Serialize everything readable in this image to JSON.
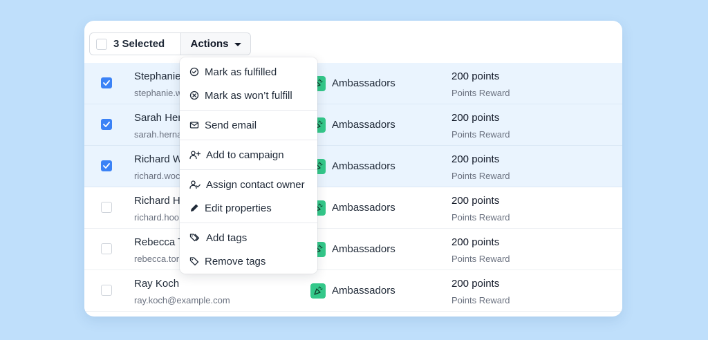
{
  "toolbar": {
    "selected_label": "3 Selected",
    "actions_label": "Actions"
  },
  "menu": {
    "mark_fulfilled": "Mark as fulfilled",
    "mark_wont_fulfill": "Mark as won’t fulfill",
    "send_email": "Send email",
    "add_to_campaign": "Add to campaign",
    "assign_owner": "Assign contact owner",
    "edit_properties": "Edit properties",
    "add_tags": "Add tags",
    "remove_tags": "Remove tags"
  },
  "rows": [
    {
      "name": "Stephanie",
      "email": "stephanie.w",
      "tier": "Ambassadors",
      "points": "200 points",
      "reward": "Points Reward",
      "checked": true
    },
    {
      "name": "Sarah Her",
      "email": "sarah.herna",
      "tier": "Ambassadors",
      "points": "200 points",
      "reward": "Points Reward",
      "checked": true
    },
    {
      "name": "Richard W",
      "email": "richard.woc",
      "tier": "Ambassadors",
      "points": "200 points",
      "reward": "Points Reward",
      "checked": true
    },
    {
      "name": "Richard H",
      "email": "richard.hoo",
      "tier": "Ambassadors",
      "points": "200 points",
      "reward": "Points Reward",
      "checked": false
    },
    {
      "name": "Rebecca T",
      "email": "rebecca.tor",
      "tier": "Ambassadors",
      "points": "200 points",
      "reward": "Points Reward",
      "checked": false
    },
    {
      "name": "Ray Koch",
      "email": "ray.koch@example.com",
      "tier": "Ambassadors",
      "points": "200 points",
      "reward": "Points Reward",
      "checked": false
    }
  ],
  "colors": {
    "accent": "#3b82f6",
    "tier_badge": "#34c88a",
    "selected_row": "#eaf4fe",
    "background": "#bfdffb"
  }
}
